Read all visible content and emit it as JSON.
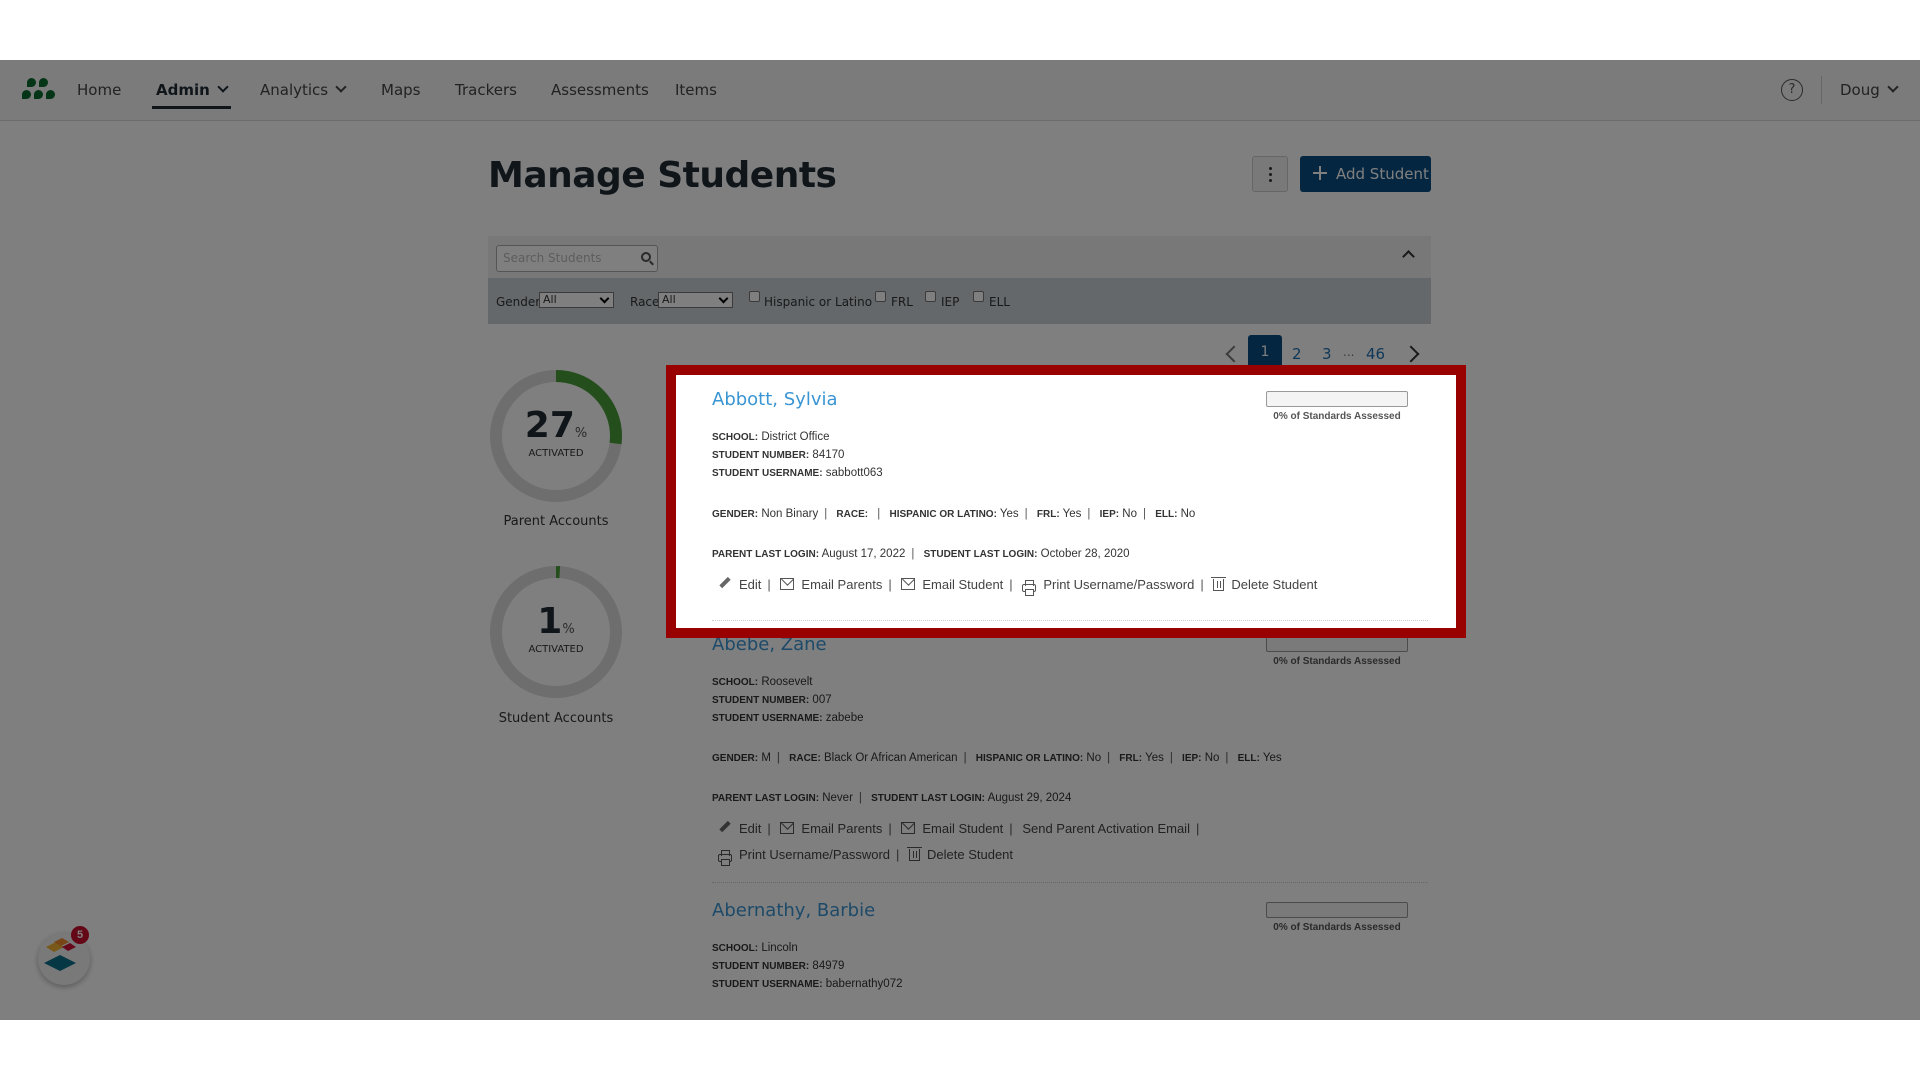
{
  "nav": {
    "items": [
      {
        "label": "Home"
      },
      {
        "label": "Admin",
        "active": true,
        "dropdown": true
      },
      {
        "label": "Analytics",
        "dropdown": true
      },
      {
        "label": "Maps"
      },
      {
        "label": "Trackers"
      },
      {
        "label": "Assessments"
      },
      {
        "label": "Items"
      }
    ],
    "help_icon": "?",
    "user": "Doug"
  },
  "page": {
    "title": "Manage Students",
    "add_button": "Add Student"
  },
  "filters": {
    "search_placeholder": "Search Students",
    "gender_label": "Gender",
    "gender_value": "All",
    "race_label": "Race",
    "race_value": "All",
    "checkboxes": [
      "Hispanic or Latino",
      "FRL",
      "IEP",
      "ELL"
    ]
  },
  "pagination": {
    "current": "1",
    "pages": [
      "2",
      "3"
    ],
    "ellipsis": "...",
    "last": "46"
  },
  "stats": {
    "parent": {
      "percent": 27,
      "percent_label": "27",
      "unit": "%",
      "sub": "ACTIVATED",
      "caption": "Parent Accounts"
    },
    "student": {
      "percent": 1,
      "percent_label": "1",
      "unit": "%",
      "sub": "ACTIVATED",
      "caption": "Student Accounts"
    }
  },
  "labels": {
    "school": "SCHOOL:",
    "student_number": "STUDENT NUMBER:",
    "student_username": "STUDENT USERNAME:",
    "gender": "GENDER:",
    "race": "RACE:",
    "hispanic": "HISPANIC OR LATINO:",
    "frl": "FRL:",
    "iep": "IEP:",
    "ell": "ELL:",
    "parent_last_login": "PARENT LAST LOGIN:",
    "student_last_login": "STUDENT LAST LOGIN:",
    "standards_suffix": "of Standards Assessed"
  },
  "actions": {
    "edit": "Edit",
    "email_parents": "Email Parents",
    "email_student": "Email Student",
    "send_activation": "Send Parent Activation Email",
    "print": "Print Username/Password",
    "delete": "Delete Student"
  },
  "students": [
    {
      "name": "Abbott, Sylvia",
      "progress": 0,
      "progress_label": "0% of Standards Assessed",
      "school": "District Office",
      "student_number": "84170",
      "username": "sabbott063",
      "gender": "Non Binary",
      "race": "",
      "hispanic": "Yes",
      "frl": "Yes",
      "iep": "No",
      "ell": "No",
      "parent_last_login": "August 17, 2022",
      "student_last_login": "October 28, 2020",
      "highlighted": true
    },
    {
      "name": "Abebe, Zane",
      "progress": 0,
      "progress_label": "0% of Standards Assessed",
      "school": "Roosevelt",
      "student_number": "007",
      "username": "zabebe",
      "gender": "M",
      "race": "Black Or African American",
      "hispanic": "No",
      "frl": "Yes",
      "iep": "No",
      "ell": "Yes",
      "parent_last_login": "Never",
      "student_last_login": "August 29, 2024"
    },
    {
      "name": "Abernathy, Barbie",
      "progress": 0,
      "progress_label": "0% of Standards Assessed",
      "school": "Lincoln",
      "student_number": "84979",
      "username": "babernathy072"
    }
  ],
  "widget": {
    "badge_count": "5"
  },
  "colors": {
    "brand_blue": "#0a4d80",
    "link_blue": "#3a95d3",
    "activated_green": "#4a9d3a",
    "highlight_red": "#990000",
    "logo_green": "#0b6b2e"
  }
}
